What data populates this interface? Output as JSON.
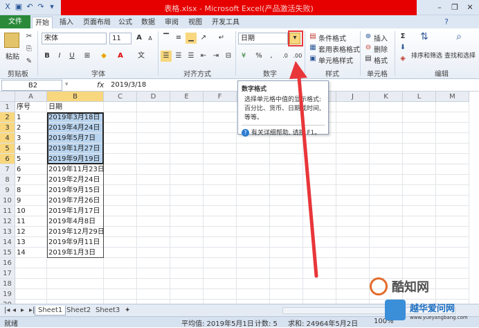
{
  "window": {
    "title": "表格.xlsx - Microsoft Excel(产品激活失败)",
    "minimize_icon": "minimize-icon",
    "restore_icon": "restore-icon",
    "close_icon": "close-icon"
  },
  "tabs": [
    "文件",
    "开始",
    "插入",
    "页面布局",
    "公式",
    "数据",
    "审阅",
    "视图",
    "开发工具"
  ],
  "ribbon": {
    "clipboard": {
      "paste": "粘贴",
      "label": "剪贴板"
    },
    "font": {
      "name": "宋体",
      "size": "11",
      "bold": "B",
      "italic": "I",
      "underline": "U",
      "grow": "A",
      "shrink": "A",
      "label": "字体"
    },
    "alignment": {
      "label": "对齐方式"
    },
    "number": {
      "format": "日期",
      "percent": "%",
      "comma": ",",
      "label": "数字"
    },
    "styles": {
      "conditional": "条件格式",
      "table": "套用表格格式",
      "cell": "单元格样式",
      "label": "样式"
    },
    "cells": {
      "insert": "插入",
      "delete": "删除",
      "format": "格式",
      "label": "单元格"
    },
    "editing": {
      "sum": "Σ",
      "sort": "排序和筛选",
      "find": "查找和选择",
      "label": "编辑"
    }
  },
  "formula_bar": {
    "name_box": "B2",
    "fx": "fx",
    "value": "2019/3/18"
  },
  "columns": [
    "A",
    "B",
    "C",
    "D",
    "E",
    "F",
    "G",
    "H",
    "I",
    "J",
    "K",
    "L",
    "M"
  ],
  "rows": [
    "1",
    "2",
    "3",
    "4",
    "5",
    "6",
    "7",
    "8",
    "9",
    "10",
    "11",
    "12",
    "13",
    "14",
    "15",
    "16",
    "17",
    "18",
    "19",
    "20"
  ],
  "sheet": {
    "header": [
      "序号",
      "日期"
    ],
    "data": [
      [
        "1",
        "2019年3月18日"
      ],
      [
        "2",
        "2019年4月24日"
      ],
      [
        "3",
        "2019年5月7日"
      ],
      [
        "4",
        "2019年1月27日"
      ],
      [
        "5",
        "2019年9月19日"
      ],
      [
        "6",
        "2019年11月23日"
      ],
      [
        "7",
        "2019年2月24日"
      ],
      [
        "8",
        "2019年9月15日"
      ],
      [
        "9",
        "2019年7月26日"
      ],
      [
        "10",
        "2019年1月17日"
      ],
      [
        "11",
        "2019年4月8日"
      ],
      [
        "12",
        "2019年12月29日"
      ],
      [
        "13",
        "2019年9月11日"
      ],
      [
        "14",
        "2019年1月3日"
      ]
    ]
  },
  "tooltip": {
    "title": "数字格式",
    "body": "选择单元格中值的显示格式: 百分比、货币、日期或时间, 等等。",
    "help": "有关详细帮助, 请按 F1。"
  },
  "sheet_tabs": [
    "Sheet1",
    "Sheet2",
    "Sheet3"
  ],
  "status": {
    "ready": "就绪",
    "average": "平均值: 2019年5月1日",
    "count": "计数: 5",
    "sum": "求和: 24964年5月2日",
    "zoom": "100%"
  },
  "watermark": {
    "brand": "酷知网",
    "site": "www.yueyangbang.com",
    "site_name": "越华爱问网"
  },
  "colors": {
    "accent": "#2a8a3a",
    "selection": "#b9d4ef",
    "arrow": "#e8363a",
    "header_highlight": "#f8d77e"
  }
}
